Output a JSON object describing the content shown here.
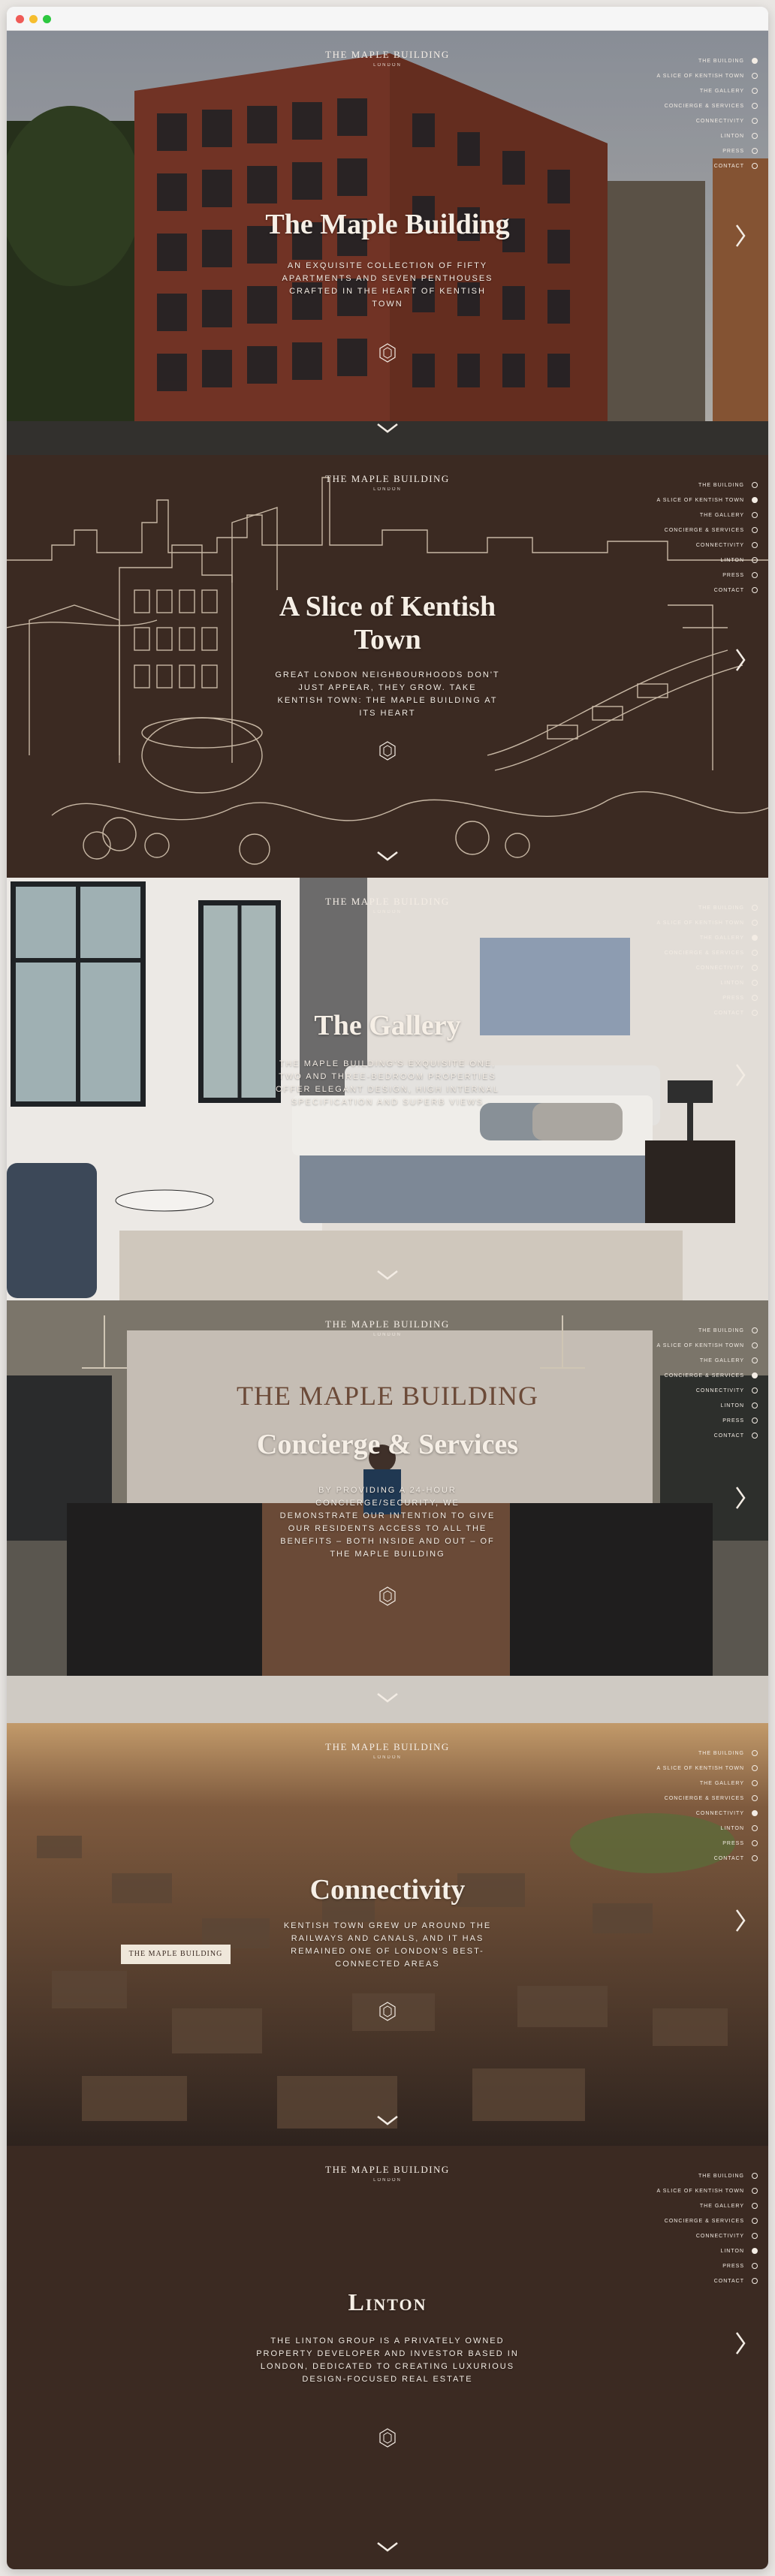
{
  "brand": {
    "name": "THE MAPLE BUILDING",
    "sub": "LONDON"
  },
  "nav": [
    "THE BUILDING",
    "A SLICE OF KENTISH TOWN",
    "THE GALLERY",
    "CONCIERGE & SERVICES",
    "CONNECTIVITY",
    "LINTON",
    "PRESS",
    "CONTACT"
  ],
  "sections": [
    {
      "title": "The Maple Building",
      "desc": "AN EXQUISITE COLLECTION OF FIFTY APARTMENTS AND SEVEN PENTHOUSES CRAFTED IN THE HEART OF KENTISH TOWN",
      "active": 0
    },
    {
      "title": "A Slice of Kentish Town",
      "desc": "GREAT LONDON NEIGHBOURHOODS DON'T JUST APPEAR, THEY GROW. TAKE KENTISH TOWN: THE MAPLE BUILDING AT ITS HEART",
      "active": 1
    },
    {
      "title": "The Gallery",
      "desc": "THE MAPLE BUILDING'S EXQUISITE ONE, TWO AND THREE-BEDROOM PROPERTIES OFFER ELEGANT DESIGN, HIGH INTERNAL SPECIFICATION AND SUPERB VIEWS",
      "active": 2
    },
    {
      "title": "Concierge & Services",
      "desc": "BY PROVIDING A 24-HOUR CONCIERGE/SECURITY, WE DEMONSTRATE OUR INTENTION TO GIVE OUR RESIDENTS ACCESS TO ALL THE BENEFITS – BOTH INSIDE AND OUT – OF THE MAPLE BUILDING",
      "active": 3,
      "sign": "THE MAPLE BUILDING"
    },
    {
      "title": "Connectivity",
      "desc": "KENTISH TOWN GREW UP AROUND THE RAILWAYS AND CANALS, AND IT HAS REMAINED ONE OF LONDON'S BEST-CONNECTED AREAS",
      "active": 4,
      "map_label": "THE MAPLE BUILDING"
    },
    {
      "title": "Linton",
      "desc": "THE LINTON GROUP IS A PRIVATELY OWNED PROPERTY DEVELOPER AND INVESTOR BASED IN LONDON, DEDICATED TO CREATING LUXURIOUS DESIGN-FOCUSED REAL ESTATE",
      "active": 5
    }
  ],
  "colors": {
    "brown": "#3b2a22",
    "cream": "#f3ece4",
    "line_art": "#d7c7b3"
  }
}
